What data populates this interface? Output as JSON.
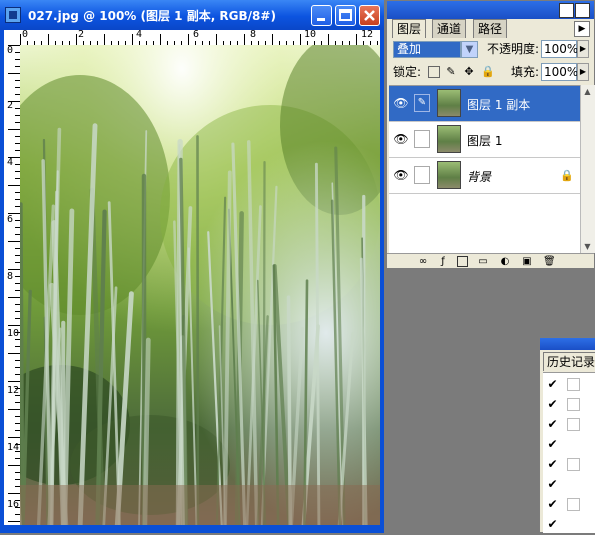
{
  "document": {
    "title": "027.jpg @ 100% (图层 1 副本, RGB/8#)",
    "ruler_top_labels": [
      "0",
      "2",
      "4",
      "6",
      "8",
      "10",
      "12"
    ],
    "ruler_left_labels": [
      "0",
      "2",
      "4",
      "6",
      "8",
      "10",
      "12",
      "14",
      "16"
    ]
  },
  "layers_panel": {
    "tabs": [
      "图层",
      "通道",
      "路径"
    ],
    "blend_mode": "叠加",
    "opacity_label": "不透明度:",
    "opacity_value": "100%",
    "lock_label": "锁定:",
    "fill_label": "填充:",
    "fill_value": "100%",
    "layers": [
      {
        "name": "图层 1 副本",
        "selected": true,
        "visible": true
      },
      {
        "name": "图层 1",
        "selected": false,
        "visible": true
      },
      {
        "name": "背景",
        "selected": false,
        "visible": true,
        "locked": true
      }
    ]
  },
  "history_panel": {
    "tab": "历史记录",
    "rows": [
      {
        "checked": true,
        "box": true
      },
      {
        "checked": true,
        "box": true
      },
      {
        "checked": true,
        "box": true
      },
      {
        "checked": true,
        "box": false
      },
      {
        "checked": true,
        "box": true
      },
      {
        "checked": true,
        "box": false
      },
      {
        "checked": true,
        "box": true
      },
      {
        "checked": true,
        "box": false
      }
    ]
  },
  "colors": {
    "title_bar": "#0c54e0",
    "selection": "#316ac5",
    "panel_bg": "#ece9d8",
    "workspace": "#7b7b7b"
  }
}
